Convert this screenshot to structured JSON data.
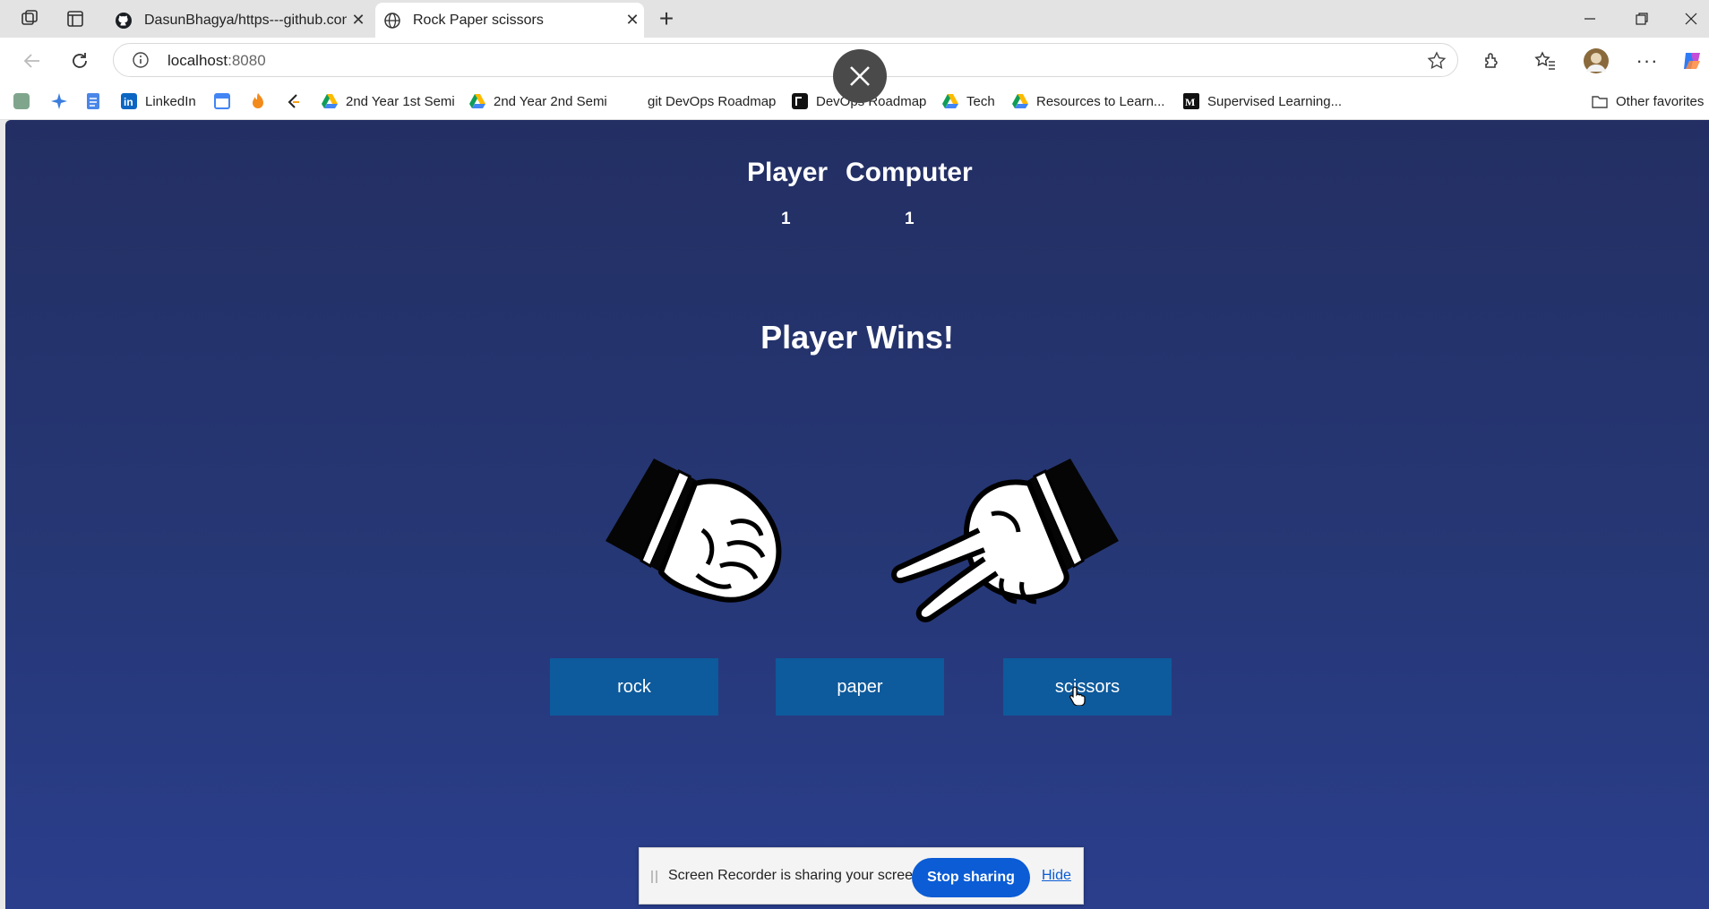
{
  "tabs": [
    {
      "label": "DasunBhagya/https---github.com",
      "icon": "github-icon"
    },
    {
      "label": "Rock Paper scissors",
      "icon": "globe-icon"
    }
  ],
  "address": {
    "host": "localhost",
    "port": ":8080"
  },
  "bookmarks": [
    {
      "label": "LinkedIn",
      "icon": "linkedin-icon"
    },
    {
      "label": "2nd Year 1st Semi",
      "icon": "drive-icon"
    },
    {
      "label": "2nd Year 2nd Semi",
      "icon": "drive-icon"
    },
    {
      "label": "git DevOps Roadmap",
      "icon": "roadmap-icon"
    },
    {
      "label": "DevOps Roadmap",
      "icon": "roadmap-icon"
    },
    {
      "label": "Tech",
      "icon": "drive-icon"
    },
    {
      "label": "Resources to Learn...",
      "icon": "drive-icon"
    },
    {
      "label": "Supervised Learning...",
      "icon": "medium-icon"
    },
    {
      "label": "Other favorites",
      "icon": "folder-icon"
    }
  ],
  "game": {
    "player_label": "Player",
    "computer_label": "Computer",
    "player_score": "1",
    "computer_score": "1",
    "result": "Player Wins!",
    "player_hand": "rock",
    "computer_hand": "scissors",
    "buttons": {
      "rock": "rock",
      "paper": "paper",
      "scissors": "scissors"
    }
  },
  "share_bar": {
    "message": "Screen Recorder is sharing your screen.",
    "stop_label": "Stop sharing",
    "hide_label": "Hide"
  },
  "colors": {
    "page_bg_top": "#232f63",
    "page_bg_bottom": "#2a3e8c",
    "button_bg": "#0d5a9c",
    "stop_button": "#0b5cd5"
  }
}
